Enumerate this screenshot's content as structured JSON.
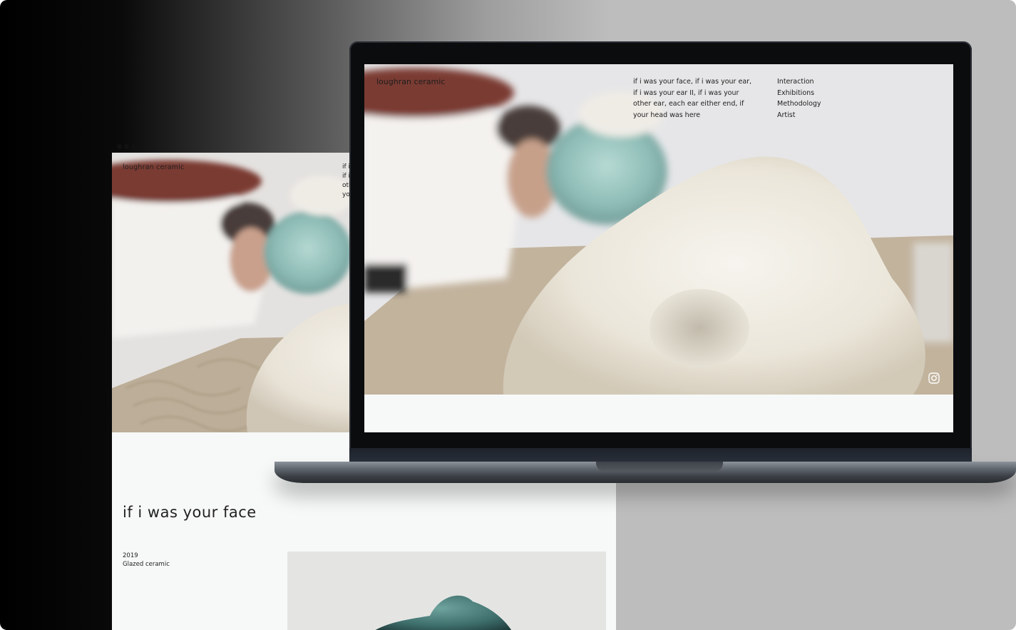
{
  "site": {
    "brand": "loughran ceramic",
    "poem": "if i was your face, if i was your ear, if i was your ear II, if i was your other ear, each ear either end, if your head was here",
    "nav": [
      "Interaction",
      "Exhibitions",
      "Methodology",
      "Artist"
    ]
  },
  "back_page": {
    "brand": "loughran ceramic",
    "poem_fragment": [
      "if i",
      "if i",
      "oth",
      "you"
    ],
    "title": "if i was your face",
    "year": "2019",
    "material": "Glazed ceramic"
  },
  "icons": {
    "social": "instagram-icon",
    "window_controls": "window-dots-icon"
  },
  "colors": {
    "page_bg": "#f7f9f8",
    "text": "#222222",
    "laptop_bezel": "#0b0c0e"
  }
}
